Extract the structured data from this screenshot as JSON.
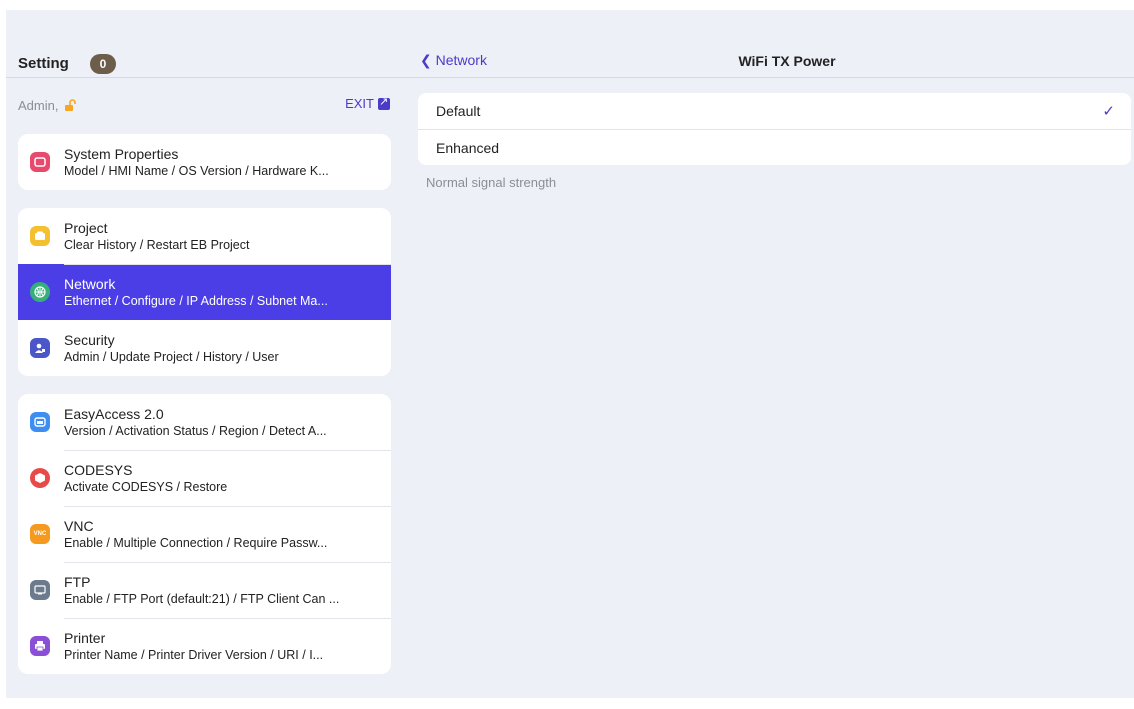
{
  "sidebar": {
    "title": "Setting",
    "badge": "0",
    "admin_label": "Admin,",
    "exit_label": "EXIT",
    "groups": [
      {
        "items": [
          {
            "title": "System Properties",
            "subtitle": "Model / HMI Name / OS Version / Hardware K...",
            "icon": "system-properties-icon",
            "color": "#e84a6e"
          }
        ]
      },
      {
        "items": [
          {
            "title": "Project",
            "subtitle": "Clear History / Restart EB Project",
            "icon": "project-icon",
            "color": "#f5c02f"
          },
          {
            "title": "Network",
            "subtitle": "Ethernet / Configure / IP Address / Subnet Ma...",
            "icon": "globe-icon",
            "color": "#36b07a"
          },
          {
            "title": "Security",
            "subtitle": "Admin / Update Project / History / User",
            "icon": "user-icon",
            "color": "#4b57c9"
          }
        ]
      },
      {
        "items": [
          {
            "title": "EasyAccess 2.0",
            "subtitle": "Version / Activation Status / Region / Detect A...",
            "icon": "easyaccess-icon",
            "color": "#3d8ef0"
          },
          {
            "title": "CODESYS",
            "subtitle": "Activate CODESYS / Restore",
            "icon": "codesys-icon",
            "color": "#e84a4a"
          },
          {
            "title": "VNC",
            "subtitle": "Enable / Multiple Connection / Require Passw...",
            "icon": "vnc-icon",
            "color": "#f59a1f"
          },
          {
            "title": "FTP",
            "subtitle": "Enable / FTP Port (default:21) / FTP Client Can ...",
            "icon": "ftp-icon",
            "color": "#6b7a8c"
          },
          {
            "title": "Printer",
            "subtitle": "Printer Name / Printer Driver Version / URI / I...",
            "icon": "printer-icon",
            "color": "#8a4fd6"
          }
        ]
      }
    ]
  },
  "main": {
    "back_label": "Network",
    "title": "WiFi TX Power",
    "options": [
      {
        "label": "Default",
        "selected": true
      },
      {
        "label": "Enhanced",
        "selected": false
      }
    ],
    "footnote": "Normal signal strength"
  },
  "colors": {
    "accent": "#4b3ee6",
    "link": "#4a3bc9",
    "background": "#eef0f7"
  }
}
